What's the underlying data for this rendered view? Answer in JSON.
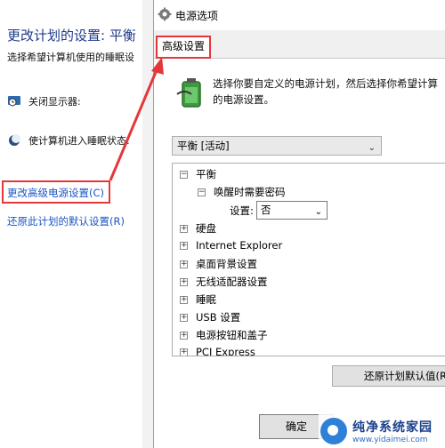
{
  "background": {
    "title": "更改计划的设置: 平衡",
    "description": "选择希望计算机使用的睡眠设",
    "display_off_label": "关闭显示器:",
    "sleep_label": "使计算机进入睡眠状态:",
    "advanced_link": "更改高级电源设置(C)",
    "restore_link": "还原此计划的默认设置(R)"
  },
  "dialog": {
    "title": "电源选项",
    "tab": "高级设置",
    "intro_line1": "选择你要自定义的电源计划，然后选择你希望计算",
    "intro_line2": "的电源设置。",
    "plan_combo": "平衡 [活动]",
    "tree": {
      "root": "平衡",
      "child": "唤醒时需要密码",
      "setting_label": "设置:",
      "setting_value": "否",
      "items": [
        "硬盘",
        "Internet Explorer",
        "桌面背景设置",
        "无线适配器设置",
        "睡眠",
        "USB 设置",
        "电源按钮和盖子",
        "PCI Express"
      ]
    },
    "restore_button": "还原计划默认值(R",
    "ok_button": "确定"
  },
  "watermark": {
    "name": "纯净系统家园",
    "url": "www.yidaimei.com"
  },
  "colors": {
    "highlight": "#e5373a",
    "link": "#1a55c4",
    "title": "#1e3a8a"
  }
}
